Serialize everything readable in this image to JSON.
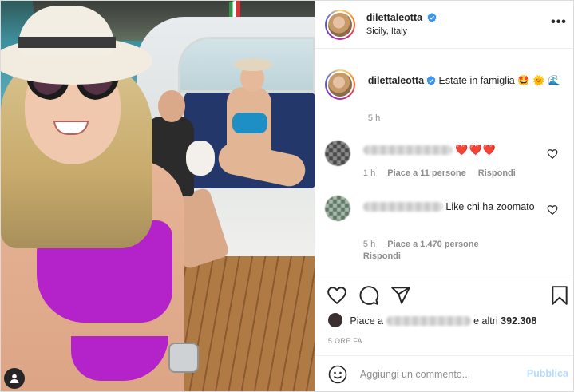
{
  "post": {
    "author": {
      "username": "dilettaleotta",
      "location": "Sicily, Italy",
      "verified": true
    },
    "caption": {
      "username": "dilettaleotta",
      "text": "Estate in famiglia",
      "emoji": "🤩 🌞 🌊",
      "time": "5 h"
    },
    "comments": [
      {
        "username_blurred": true,
        "text": "❤️❤️❤️",
        "time": "1 h",
        "likes_label": "Piace a 11 persone",
        "reply_label": "Rispondi"
      },
      {
        "username_blurred": true,
        "text": "Like chi ha zoomato",
        "time": "5 h",
        "likes_label": "Piace a 1.470 persone",
        "reply_label": "Rispondi"
      }
    ],
    "likes": {
      "prefix": "Piace a",
      "middle": "e altri",
      "count": "392.308"
    },
    "posted_ago": "5 ORE FA",
    "add_comment_placeholder": "Aggiungi un commento...",
    "publish_label": "Pubblica"
  },
  "icons": {
    "more": "more-horizontal-icon",
    "heart": "heart-icon",
    "comment": "comment-icon",
    "share": "share-icon",
    "save": "bookmark-icon",
    "emoji": "emoji-icon",
    "tag": "user-tag-icon",
    "verified": "verified-badge-icon"
  },
  "colors": {
    "verified_blue": "#3897f0",
    "publish_disabled": "#b3dbff",
    "secondary_text": "#8e8e8e"
  }
}
